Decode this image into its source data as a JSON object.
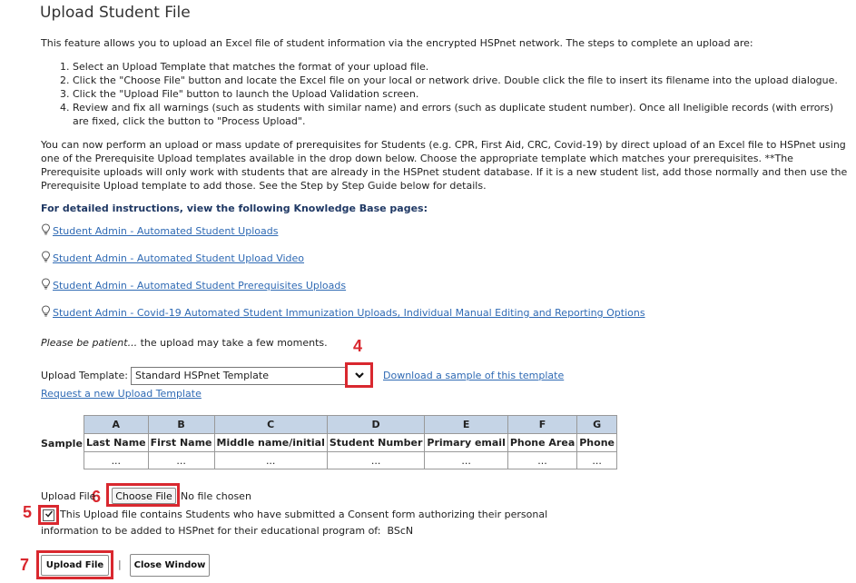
{
  "page": {
    "title": "Upload Student File",
    "intro": "This feature allows you to upload an Excel file of student information via the encrypted HSPnet network. The steps to complete an upload are:",
    "steps": [
      "Select an Upload Template that matches the format of your upload file.",
      "Click the \"Choose File\" button and locate the Excel file on your local or network drive. Double click the file to insert its filename into the upload dialogue.",
      "Click the \"Upload File\" button to launch the Upload Validation screen.",
      "Review and fix all warnings (such as students with similar name) and errors (such as duplicate student number). Once all Ineligible records (with errors) are fixed, click the button to \"Process Upload\"."
    ],
    "prereq_text": "You can now perform an upload or mass update of prerequisites for Students (e.g. CPR, First Aid, CRC, Covid-19) by direct upload of an Excel file to HSPnet using one of the Prerequisite Upload templates available in the drop down below. Choose the appropriate template which matches your prerequisites. **The Prerequisite uploads will only work with students that are already in the HSPnet student database. If it is a new student list, add those normally and then use the Prerequisite Upload template to add those. See the Step by Step Guide below for details.",
    "kb_heading": "For detailed instructions, view the following Knowledge Base pages:",
    "kb_links": [
      "Student Admin - Automated Student Uploads",
      "Student Admin - Automated Student Upload Video",
      "Student Admin - Automated Student Prerequisites Uploads",
      "Student Admin - Covid-19 Automated Student Immunization Uploads, Individual Manual Editing and Reporting Options"
    ],
    "patient_em": "Please be patient...",
    "patient_rest": " the upload may take a few moments."
  },
  "template": {
    "label": "Upload Template:",
    "selected": "Standard HSPnet Template",
    "download_link": "Download a sample of this template",
    "request_link": "Request a new Upload Template"
  },
  "sample": {
    "label": "Sample:",
    "columns": [
      {
        "letter": "A",
        "header": "Last Name",
        "cell": "..."
      },
      {
        "letter": "B",
        "header": "First Name",
        "cell": "..."
      },
      {
        "letter": "C",
        "header": "Middle name/initial",
        "cell": "..."
      },
      {
        "letter": "D",
        "header": "Student Number",
        "cell": "..."
      },
      {
        "letter": "E",
        "header": "Primary email",
        "cell": "..."
      },
      {
        "letter": "F",
        "header": "Phone Area",
        "cell": "..."
      },
      {
        "letter": "G",
        "header": "Phone",
        "cell": "..."
      }
    ]
  },
  "upload": {
    "file_label": "Upload File",
    "choose_button": "Choose File",
    "no_file": "No file chosen",
    "consent_line1": "This Upload file contains Students who have submitted a Consent form authorizing their personal",
    "consent_line2": "information to be added to HSPnet for their educational program of:",
    "program": "BScN",
    "consent_checked": true,
    "upload_button": "Upload File",
    "separator": "|",
    "close_button": "Close Window"
  },
  "markers": {
    "m4": "4",
    "m5": "5",
    "m6": "6",
    "m7": "7"
  },
  "colors": {
    "annotation_red": "#d9282f",
    "link_blue": "#2f6ab4",
    "table_header": "#c5d4e6",
    "kb_heading": "#1f3864"
  }
}
